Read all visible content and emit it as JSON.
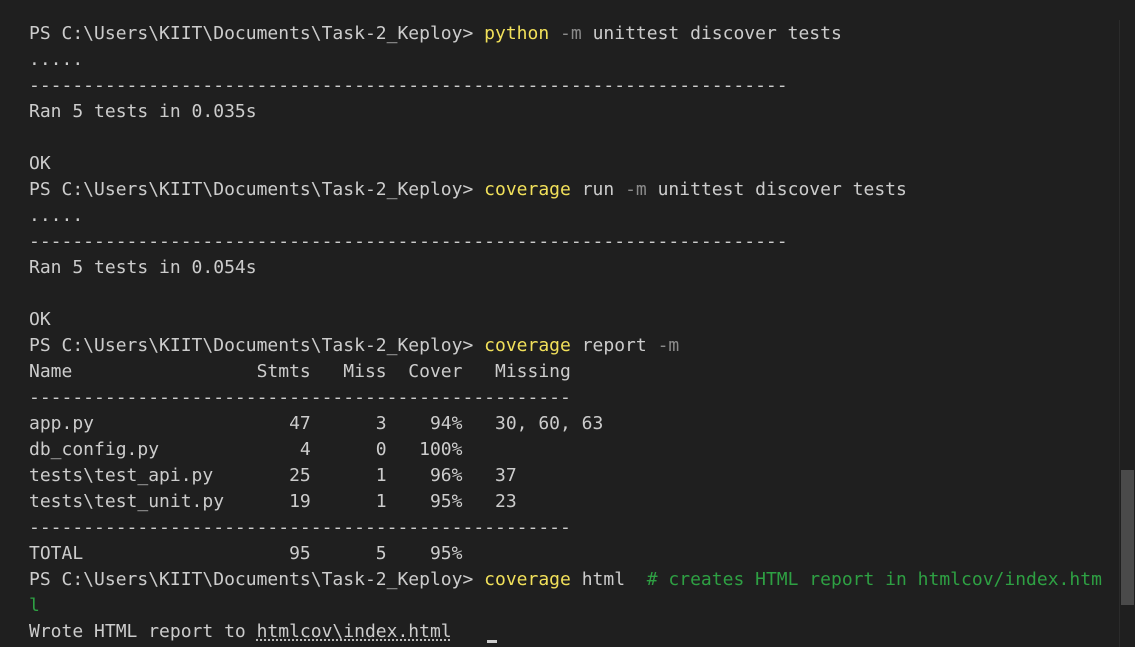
{
  "prompt": "PS C:\\Users\\KIIT\\Documents\\Task-2_Keploy> ",
  "cmd1": {
    "exe": "python",
    "flag": "-m",
    "rest": "unittest discover tests"
  },
  "run1": {
    "dots": ".....",
    "divider": "----------------------------------------------------------------------",
    "ran": "Ran 5 tests in 0.035s",
    "ok": "OK"
  },
  "cmd2": {
    "exe": "coverage",
    "rest1": "run",
    "flag": "-m",
    "rest2": "unittest discover tests"
  },
  "run2": {
    "dots": ".....",
    "divider": "----------------------------------------------------------------------",
    "ran": "Ran 5 tests in 0.054s",
    "ok": "OK"
  },
  "cmd3": {
    "exe": "coverage",
    "rest": "report",
    "flag": "-m"
  },
  "report": {
    "header": "Name                 Stmts   Miss  Cover   Missing",
    "divider": "--------------------------------------------------",
    "rows": [
      "app.py                  47      3    94%   30, 60, 63",
      "db_config.py             4      0   100%",
      "tests\\test_api.py       25      1    96%   37",
      "tests\\test_unit.py      19      1    95%   23"
    ],
    "total": "TOTAL                   95      5    95%"
  },
  "cmd4": {
    "exe": "coverage",
    "rest": "html",
    "comment": "# creates HTML report in htmlcov/index.htm",
    "wrap": "l"
  },
  "output": {
    "wrote_prefix": "Wrote HTML report to ",
    "wrote_path": "htmlcov\\index.html"
  }
}
